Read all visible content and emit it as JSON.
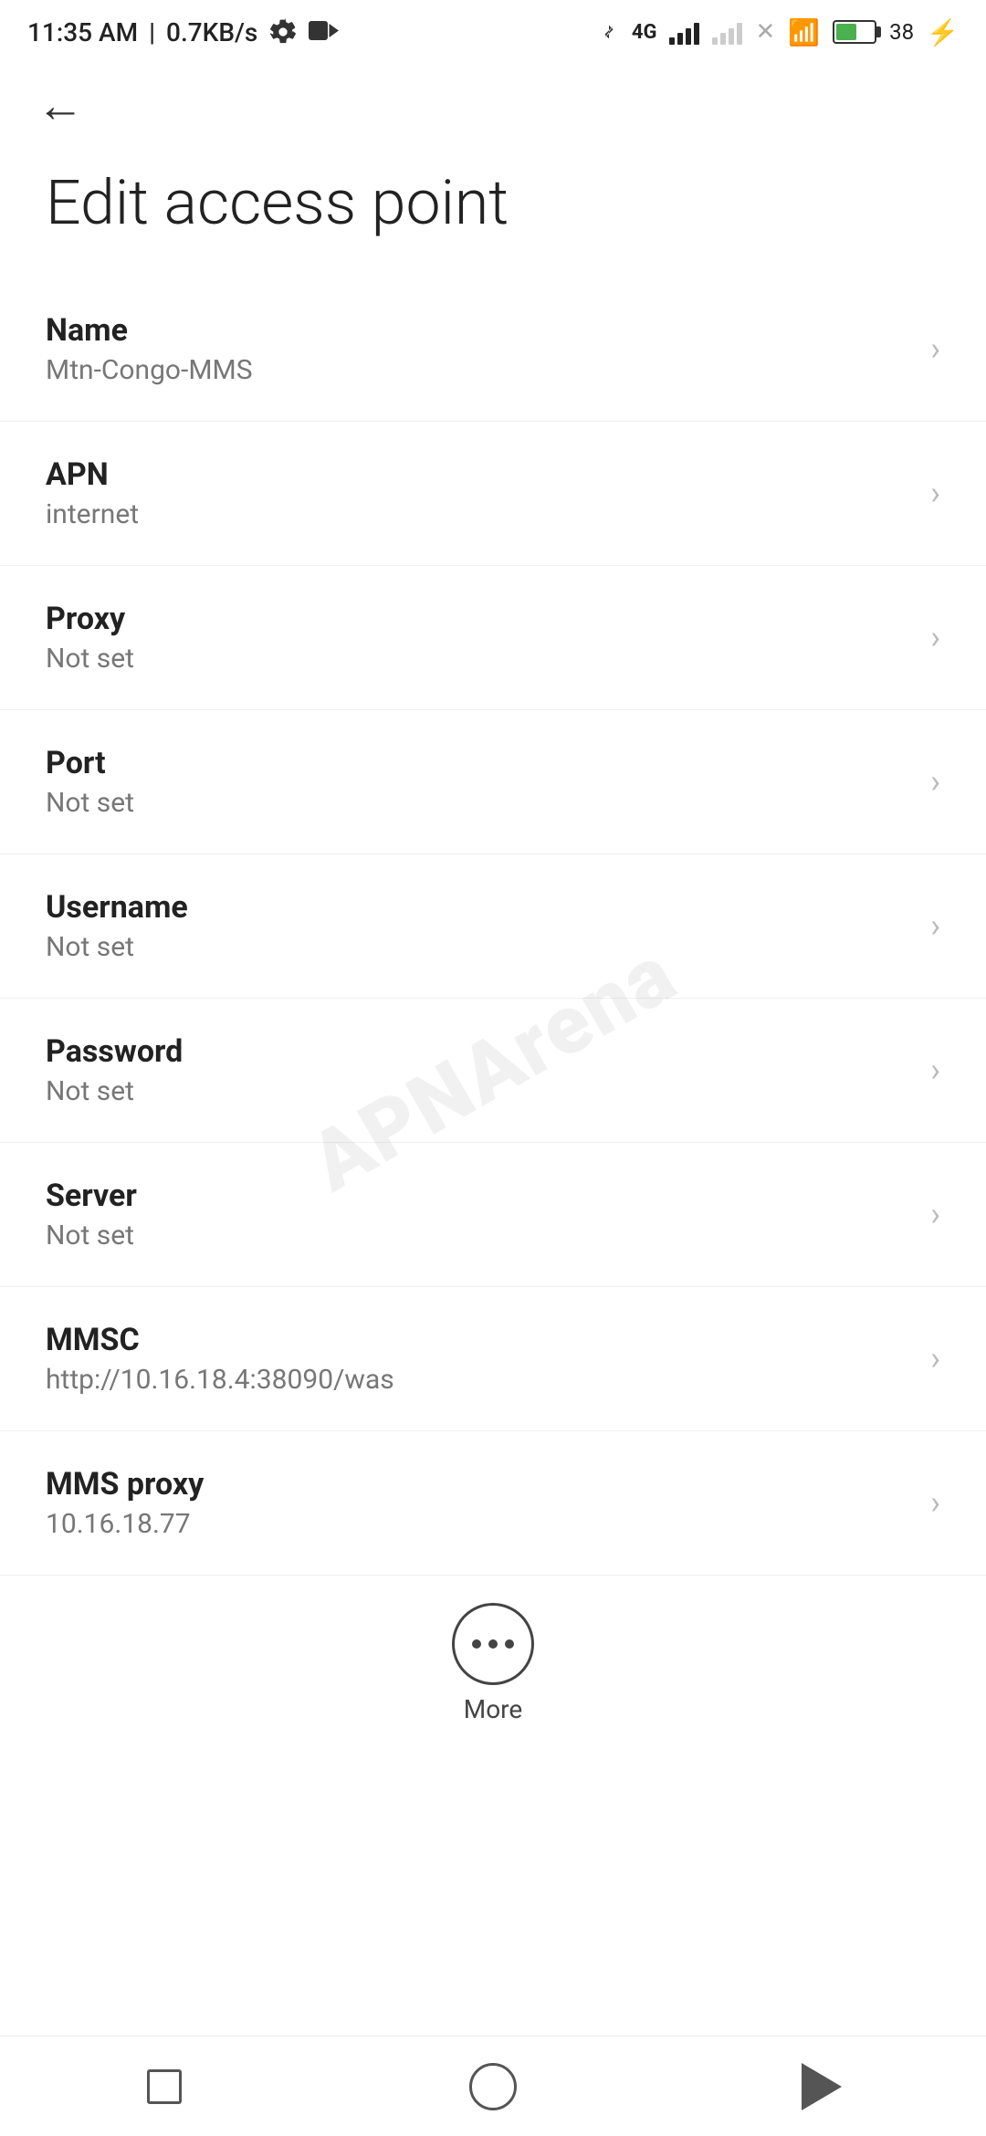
{
  "statusBar": {
    "time": "11:35 AM",
    "speed": "0.7KB/s"
  },
  "navigation": {
    "backArrow": "←"
  },
  "pageTitle": "Edit access point",
  "settingsItems": [
    {
      "label": "Name",
      "value": "Mtn-Congo-MMS"
    },
    {
      "label": "APN",
      "value": "internet"
    },
    {
      "label": "Proxy",
      "value": "Not set"
    },
    {
      "label": "Port",
      "value": "Not set"
    },
    {
      "label": "Username",
      "value": "Not set"
    },
    {
      "label": "Password",
      "value": "Not set"
    },
    {
      "label": "Server",
      "value": "Not set"
    },
    {
      "label": "MMSC",
      "value": "http://10.16.18.4:38090/was"
    },
    {
      "label": "MMS proxy",
      "value": "10.16.18.77"
    }
  ],
  "moreButton": {
    "label": "More"
  },
  "bottomNav": {
    "square": "",
    "circle": "",
    "triangle": ""
  },
  "watermark": "APNArena"
}
